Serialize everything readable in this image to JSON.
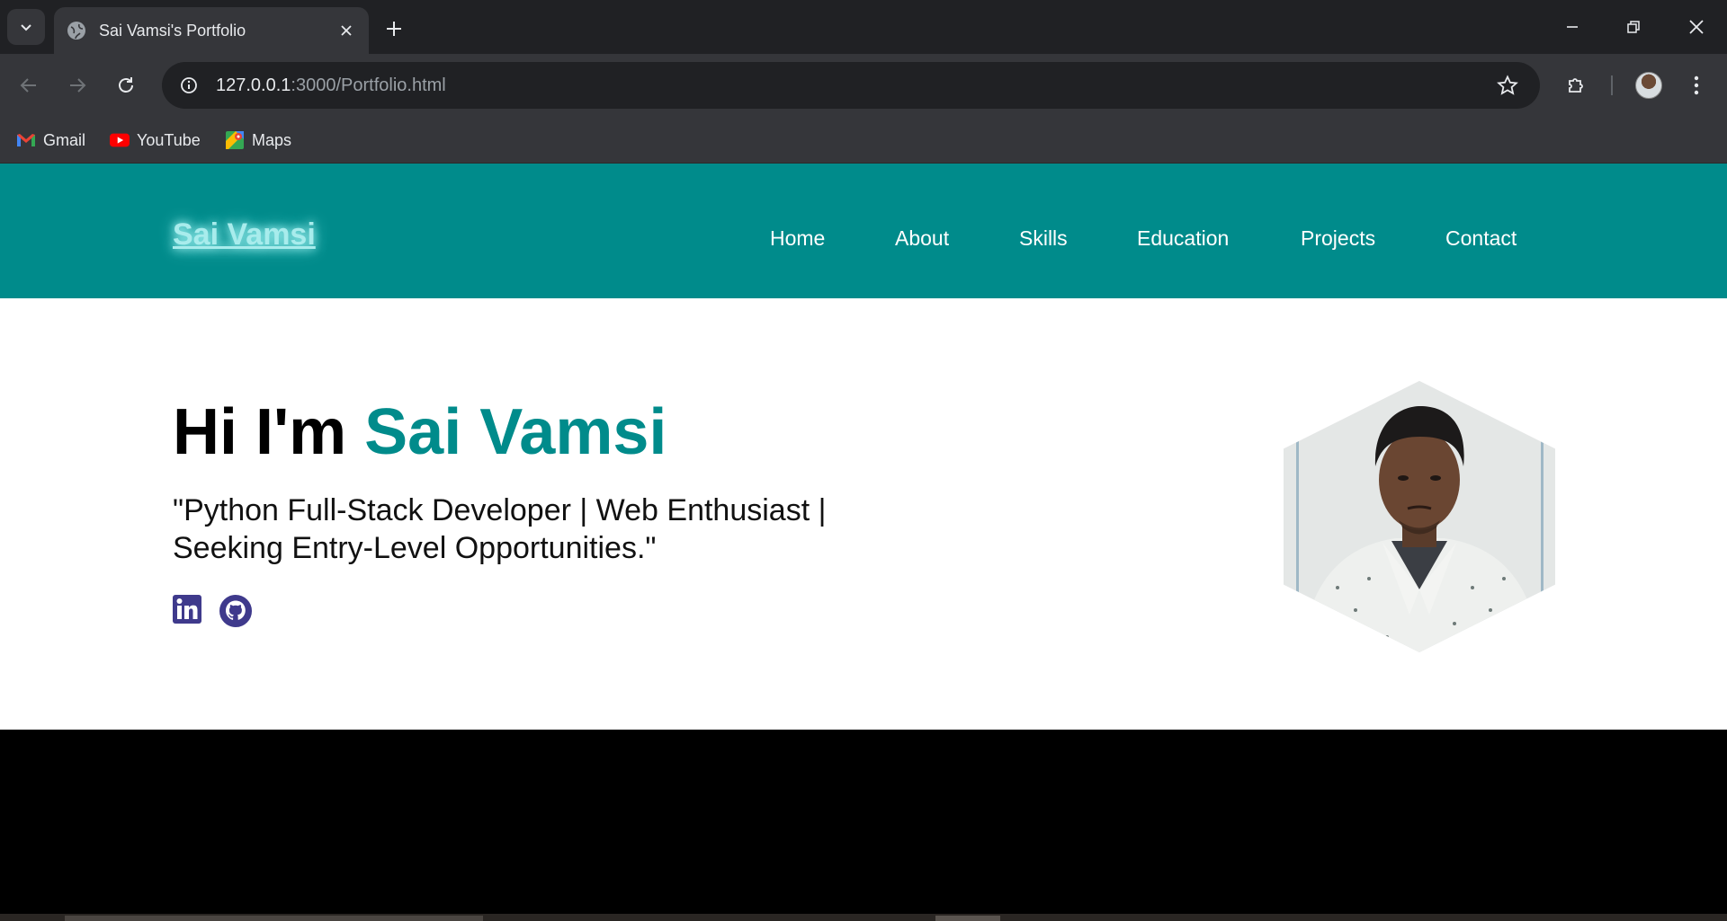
{
  "browser": {
    "tab": {
      "title": "Sai Vamsi's Portfolio"
    },
    "address": {
      "host": "127.0.0.1",
      "rest": ":3000/Portfolio.html"
    },
    "bookmarks": [
      {
        "label": "Gmail",
        "icon": "gmail-icon"
      },
      {
        "label": "YouTube",
        "icon": "youtube-icon"
      },
      {
        "label": "Maps",
        "icon": "maps-icon"
      }
    ]
  },
  "site": {
    "brand": "Sai Vamsi",
    "nav": [
      "Home",
      "About",
      "Skills",
      "Education",
      "Projects",
      "Contact"
    ],
    "hero": {
      "greeting": "Hi I'm ",
      "name": "Sai Vamsi",
      "tagline": "\"Python Full-Stack Developer | Web Enthusiast | Seeking Entry-Level Opportunities.\""
    },
    "social": [
      {
        "name": "linkedin-icon"
      },
      {
        "name": "github-icon"
      }
    ]
  },
  "colors": {
    "header_teal": "#008b8b",
    "accent": "#008b8b",
    "social_icon": "#3f3a8c"
  }
}
